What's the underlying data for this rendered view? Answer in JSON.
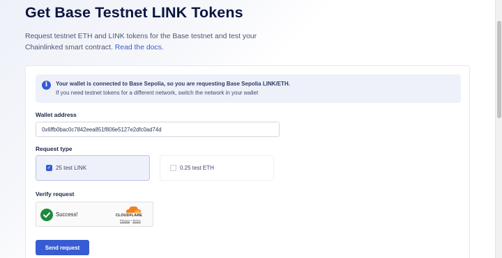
{
  "page": {
    "title": "Get Base Testnet LINK Tokens",
    "intro": "Request testnet ETH and LINK tokens for the Base testnet and test your Chainlinked smart contract.",
    "docs_link": "Read the docs."
  },
  "info": {
    "title": "Your wallet is connected to Base Sepolia, so you are requesting Base Sepolia LINK/ETH.",
    "body": "If you need testnet tokens for a different network, switch the network in your wallet",
    "icon": "info-icon",
    "accent": "#375bd2"
  },
  "wallet": {
    "label": "Wallet address",
    "value": "0x6ffb0bac0c7842eea851f806e5127e2dfc0ad74d"
  },
  "request_type": {
    "label": "Request type",
    "options": [
      {
        "label": "25 test LINK",
        "checked": true
      },
      {
        "label": "0.25 test ETH",
        "checked": false
      }
    ]
  },
  "verify": {
    "label": "Verify request",
    "status": "Success!",
    "provider": "CLOUDFLARE",
    "privacy": "Privacy",
    "separator": "•",
    "terms": "Terms"
  },
  "actions": {
    "send_label": "Send request",
    "button_color": "#375bd2"
  }
}
